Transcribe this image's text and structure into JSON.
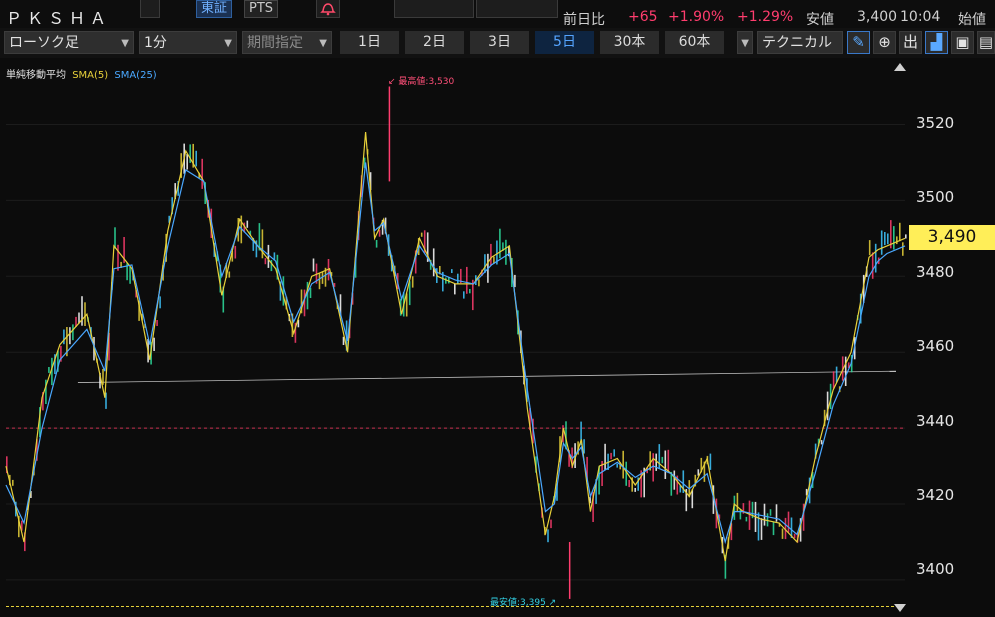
{
  "header": {
    "ticker": "ＰＫＳＨＡ",
    "markets": [
      {
        "label": "東証",
        "active": true
      },
      {
        "label": "PTS",
        "active": false
      }
    ],
    "change_label": "前日比",
    "change_value": "+65",
    "change_pct": "+1.90%",
    "change_pct2": "+1.29%",
    "low_label": "安値",
    "low_value": "3,400",
    "time": "10:04",
    "open_label": "始値"
  },
  "toolbar": {
    "chart_type": "ローソク足",
    "interval": "1分",
    "period_select": "期間指定",
    "ranges": [
      {
        "label": "1日",
        "active": false
      },
      {
        "label": "2日",
        "active": false
      },
      {
        "label": "3日",
        "active": false
      },
      {
        "label": "5日",
        "active": true
      },
      {
        "label": "30本",
        "active": false
      },
      {
        "label": "60本",
        "active": false
      }
    ],
    "technical_label": "テクニカル",
    "tool_icons": [
      "pencil-icon",
      "zoom-icon",
      "出",
      "area-chart-icon",
      "save-icon",
      "layout-icon"
    ],
    "tool_glyphs": [
      "✎",
      "⊕",
      "出",
      "▟",
      "▣",
      "▤"
    ]
  },
  "legend": {
    "title": "単純移動平均",
    "sma5": "SMA(5)",
    "sma25": "SMA(25)"
  },
  "annotations": {
    "high": "最高値:3,530",
    "low": "最安値:3,395"
  },
  "colors": {
    "up": "#ff3d6e",
    "sma5": "#e8d13a",
    "sma25": "#4aa8ff",
    "current_price_bg": "#ffee58",
    "ref_line": "#c8304f",
    "trend_line": "#bdbdbd"
  },
  "chart_data": {
    "type": "line",
    "title": "",
    "xlabel": "",
    "ylabel": "",
    "ylim": [
      3393,
      3530
    ],
    "y_ticks": [
      "3520",
      "3500",
      "3480",
      "3460",
      "3440",
      "3420",
      "3400"
    ],
    "current_price": "3,490",
    "reference_line": 3440,
    "bottom_line": 3393,
    "trend_line": {
      "start": [
        0.08,
        3452
      ],
      "end": [
        0.99,
        3455
      ]
    },
    "high": 3530,
    "low": 3395,
    "series": [
      {
        "name": "SMA(5)",
        "x": [
          0,
          0.02,
          0.04,
          0.06,
          0.09,
          0.11,
          0.12,
          0.14,
          0.16,
          0.18,
          0.2,
          0.22,
          0.24,
          0.26,
          0.28,
          0.3,
          0.32,
          0.34,
          0.36,
          0.38,
          0.4,
          0.41,
          0.42,
          0.44,
          0.46,
          0.48,
          0.5,
          0.52,
          0.54,
          0.56,
          0.58,
          0.6,
          0.61,
          0.62,
          0.63,
          0.64,
          0.65,
          0.66,
          0.68,
          0.7,
          0.72,
          0.74,
          0.76,
          0.78,
          0.8,
          0.81,
          0.82,
          0.84,
          0.86,
          0.88,
          0.9,
          0.92,
          0.94,
          0.96,
          0.97,
          0.98,
          1.0
        ],
        "values": [
          3430,
          3410,
          3448,
          3462,
          3470,
          3448,
          3488,
          3482,
          3458,
          3492,
          3513,
          3505,
          3475,
          3495,
          3488,
          3482,
          3465,
          3480,
          3482,
          3460,
          3518,
          3490,
          3495,
          3470,
          3490,
          3480,
          3478,
          3478,
          3485,
          3488,
          3445,
          3412,
          3422,
          3440,
          3430,
          3437,
          3418,
          3430,
          3432,
          3425,
          3432,
          3428,
          3422,
          3432,
          3405,
          3420,
          3418,
          3416,
          3415,
          3410,
          3432,
          3450,
          3460,
          3485,
          3487,
          3488,
          3490
        ]
      },
      {
        "name": "SMA(25)",
        "x": [
          0,
          0.02,
          0.04,
          0.06,
          0.09,
          0.11,
          0.12,
          0.14,
          0.16,
          0.18,
          0.2,
          0.22,
          0.24,
          0.26,
          0.28,
          0.3,
          0.32,
          0.34,
          0.36,
          0.38,
          0.4,
          0.41,
          0.42,
          0.44,
          0.46,
          0.48,
          0.5,
          0.52,
          0.54,
          0.56,
          0.58,
          0.6,
          0.61,
          0.62,
          0.63,
          0.64,
          0.65,
          0.66,
          0.68,
          0.7,
          0.72,
          0.74,
          0.76,
          0.78,
          0.8,
          0.81,
          0.82,
          0.84,
          0.86,
          0.88,
          0.9,
          0.92,
          0.94,
          0.96,
          0.97,
          0.98,
          1.0
        ],
        "values": [
          3425,
          3415,
          3440,
          3458,
          3466,
          3455,
          3482,
          3483,
          3462,
          3488,
          3508,
          3505,
          3480,
          3493,
          3488,
          3484,
          3468,
          3478,
          3481,
          3463,
          3510,
          3492,
          3494,
          3474,
          3488,
          3481,
          3479,
          3478,
          3483,
          3486,
          3450,
          3418,
          3420,
          3436,
          3432,
          3435,
          3422,
          3428,
          3431,
          3427,
          3430,
          3428,
          3424,
          3428,
          3410,
          3418,
          3418,
          3417,
          3416,
          3412,
          3428,
          3446,
          3457,
          3480,
          3484,
          3486,
          3488
        ]
      }
    ]
  }
}
